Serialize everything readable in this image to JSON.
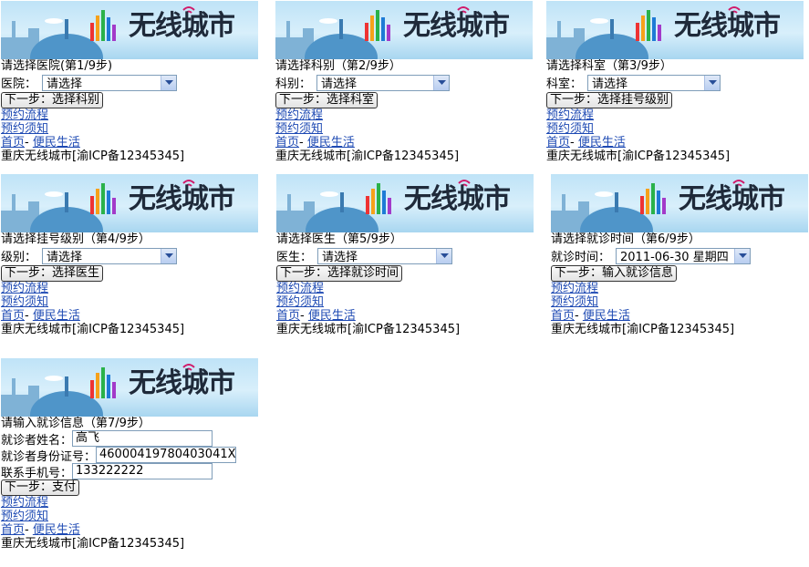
{
  "brand": "无线城市",
  "nav": {
    "flow": "预约流程",
    "notice": "预约须知",
    "home": "首页",
    "sep": "- ",
    "life": "便民生活",
    "footer": "重庆无线城市[渝ICP备12345345]"
  },
  "panels": [
    {
      "title": "请选择医院(第1/9步)",
      "label": "医院：",
      "select": "请选择",
      "button": "下一步：选择科别"
    },
    {
      "title": "请选择科别（第2/9步）",
      "label": "科别：",
      "select": "请选择",
      "button": "下一步：选择科室"
    },
    {
      "title": "请选择科室（第3/9步）",
      "label": "科室：",
      "select": "请选择",
      "button": "下一步：选择挂号级别"
    },
    {
      "title": "请选择挂号级别（第4/9步）",
      "label": "级别：",
      "select": "请选择",
      "button": "下一步：选择医生"
    },
    {
      "title": "请选择医生（第5/9步）",
      "label": "医生：",
      "select": "请选择",
      "button": "下一步：选择就诊时间"
    },
    {
      "title": "请选择就诊时间（第6/9步）",
      "label": "就诊时间：",
      "select": "2011-06-30 星期四",
      "button": "下一步：输入就诊信息"
    }
  ],
  "form": {
    "title": "请输入就诊信息（第7/9步）",
    "name_label": "就诊者姓名：",
    "name_value": "高飞",
    "id_label": "就诊者身份证号：",
    "id_value": "46000419780403041X",
    "phone_label": "联系手机号：",
    "phone_value": "133222222",
    "button": "下一步：支付"
  }
}
